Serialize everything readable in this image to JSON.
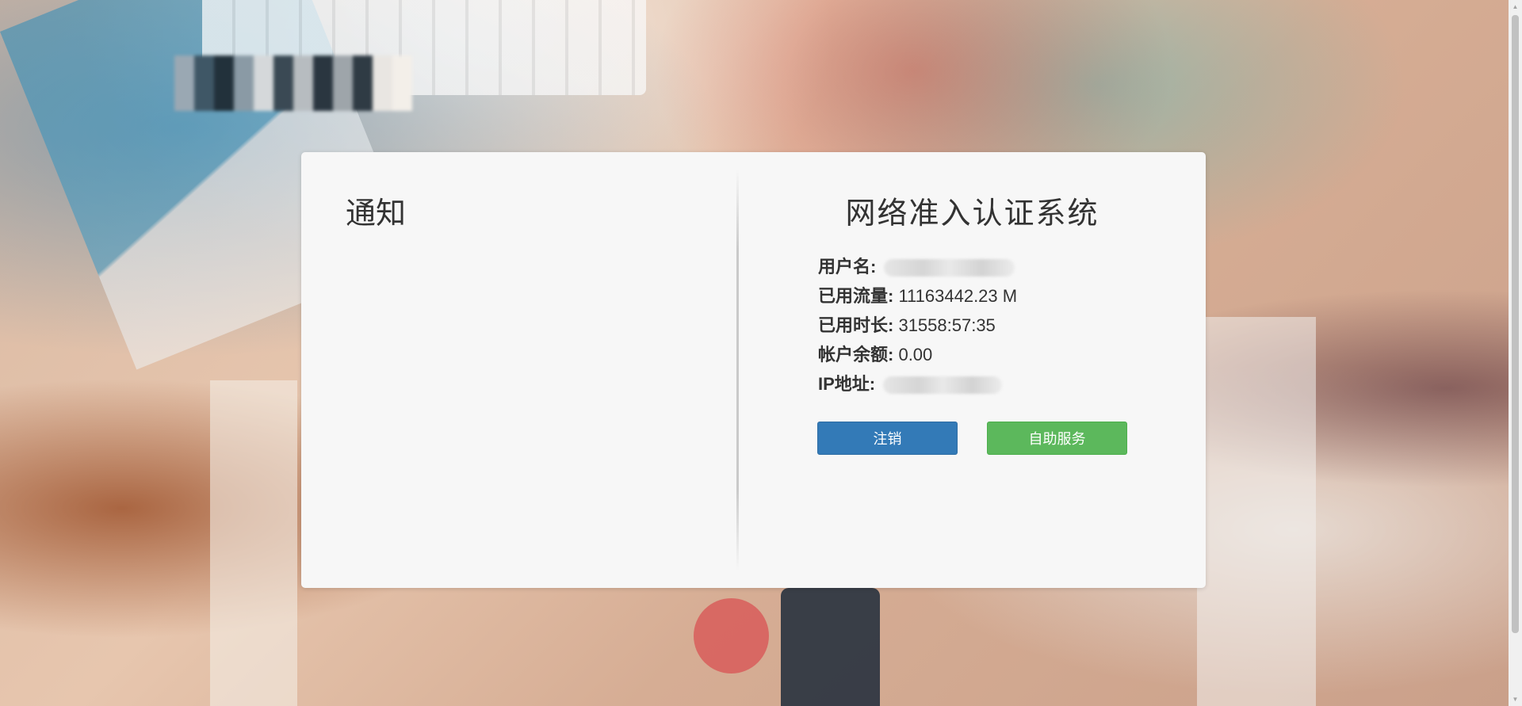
{
  "notice": {
    "title": "通知"
  },
  "auth": {
    "title": "网络准入认证系统",
    "fields": [
      {
        "label": "用户名:",
        "value": ""
      },
      {
        "label": "已用流量:",
        "value": "11163442.23 M"
      },
      {
        "label": "已用时长:",
        "value": "31558:57:35"
      },
      {
        "label": "帐户余额:",
        "value": "0.00"
      },
      {
        "label": "IP地址:",
        "value": ""
      }
    ],
    "buttons": {
      "logout": "注销",
      "self_service": "自助服务"
    }
  },
  "colors": {
    "primary": "#337ab7",
    "success": "#5cb85c",
    "panel_bg": "#f7f7f7"
  }
}
